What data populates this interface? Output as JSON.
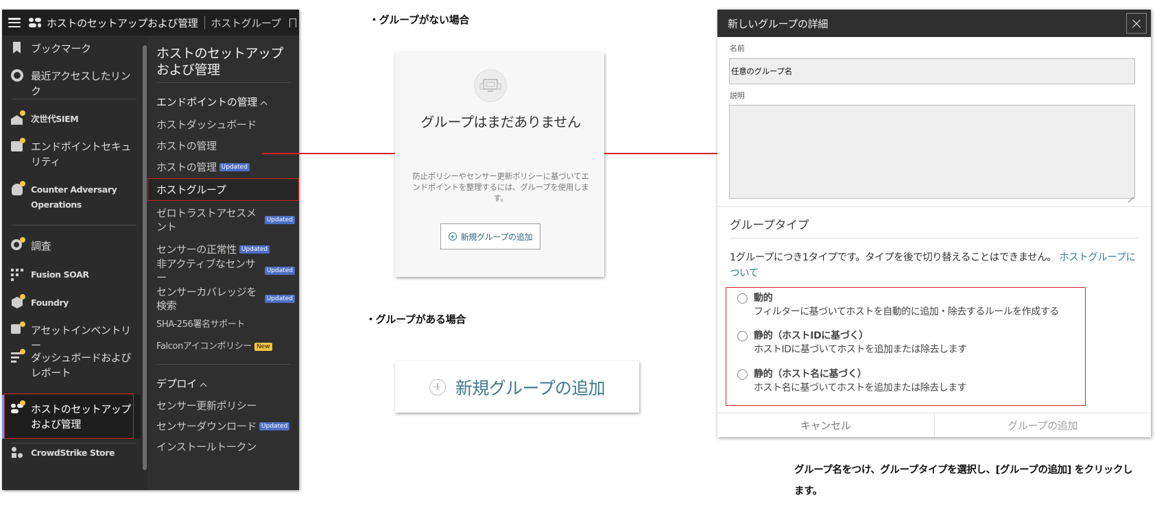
{
  "console": {
    "topbar": {
      "app_title": "ホストのセットアップおよび管理",
      "breadcrumb": "ホストグループ"
    },
    "left_nav": [
      {
        "label": "ブックマーク",
        "icon": "bookmark-icon"
      },
      {
        "label": "最近アクセスしたリンク",
        "icon": "history-icon"
      },
      {
        "label": "次世代SIEM",
        "icon": "siem-icon"
      },
      {
        "label": "エンドポイントセキュリティ",
        "icon": "endpoint-security-icon"
      },
      {
        "label": "Counter Adversary Operations",
        "icon": "counter-adversary-icon"
      },
      {
        "label": "調査",
        "icon": "investigate-icon"
      },
      {
        "label": "Fusion SOAR",
        "icon": "fusion-soar-icon"
      },
      {
        "label": "Foundry",
        "icon": "foundry-icon"
      },
      {
        "label": "アセットインベントリー",
        "icon": "asset-inventory-icon"
      },
      {
        "label": "ダッシュボードおよびレポート",
        "icon": "dashboard-icon"
      },
      {
        "label": "ホストのセットアップおよび管理",
        "icon": "host-setup-icon"
      },
      {
        "label": "CrowdStrike Store",
        "icon": "store-icon"
      }
    ],
    "right_nav": {
      "title": "ホストのセットアップおよび管理",
      "group1": "エンドポイントの管理",
      "group1_items": [
        {
          "label": "ホストダッシュボード",
          "badge": ""
        },
        {
          "label": "ホストの管理",
          "badge": ""
        },
        {
          "label": "ホストの管理",
          "badge": "Updated"
        },
        {
          "label": "ホストグループ",
          "badge": ""
        },
        {
          "label": "ゼロトラストアセスメント",
          "badge": "Updated"
        },
        {
          "label": "センサーの正常性",
          "badge": "Updated"
        },
        {
          "label": "非アクティブなセンサー",
          "badge": "Updated"
        },
        {
          "label": "センサーカバレッジを検索",
          "badge": "Updated"
        },
        {
          "label": "SHA-256署名サポート",
          "badge": ""
        },
        {
          "label": "Falconアイコンポリシー",
          "badge": "New"
        }
      ],
      "group2": "デプロイ",
      "group2_items": [
        {
          "label": "センサー更新ポリシー",
          "badge": ""
        },
        {
          "label": "センサーダウンロード",
          "badge": "Updated"
        },
        {
          "label": "インストールトークン",
          "badge": ""
        }
      ]
    }
  },
  "middle": {
    "no_group_heading": "・グループがない場合",
    "empty_title": "グループはまだありません",
    "empty_description": "防止ポリシーやセンサー更新ポリシーに基づいてエンドポイントを整理するには、グループを使用します。",
    "add_button": "新規グループの追加",
    "has_group_heading": "・グループがある場合",
    "big_add_button": "新規グループの追加"
  },
  "dialog": {
    "title": "新しいグループの詳細",
    "name_label": "名前",
    "name_value": "任意のグループ名",
    "description_label": "説明",
    "group_type_title": "グループタイプ",
    "group_type_desc": "1グループにつき1タイプです。タイプを後で切り替えることはできません。",
    "group_type_link": "ホストグループについて",
    "options": [
      {
        "title": "動的",
        "desc": "フィルターに基づいてホストを自動的に追加・除去するルールを作成する"
      },
      {
        "title": "静的（ホストIDに基づく）",
        "desc": "ホストIDに基づいてホストを追加または除去します"
      },
      {
        "title": "静的（ホスト名に基づく）",
        "desc": "ホスト名に基づいてホストを追加または除去します"
      }
    ],
    "cancel": "キャンセル",
    "add": "グループの追加"
  },
  "caption": "グループ名をつけ、グループタイプを選択し、[グループの追加] をクリックします。",
  "colors": {
    "highlight": "#d62020",
    "accent_link": "#2f7fa6",
    "console_bg": "#2b2b2b",
    "badge_updated": "#4c6fc4",
    "badge_new": "#f4c542",
    "notify_dot": "#f4c542"
  }
}
